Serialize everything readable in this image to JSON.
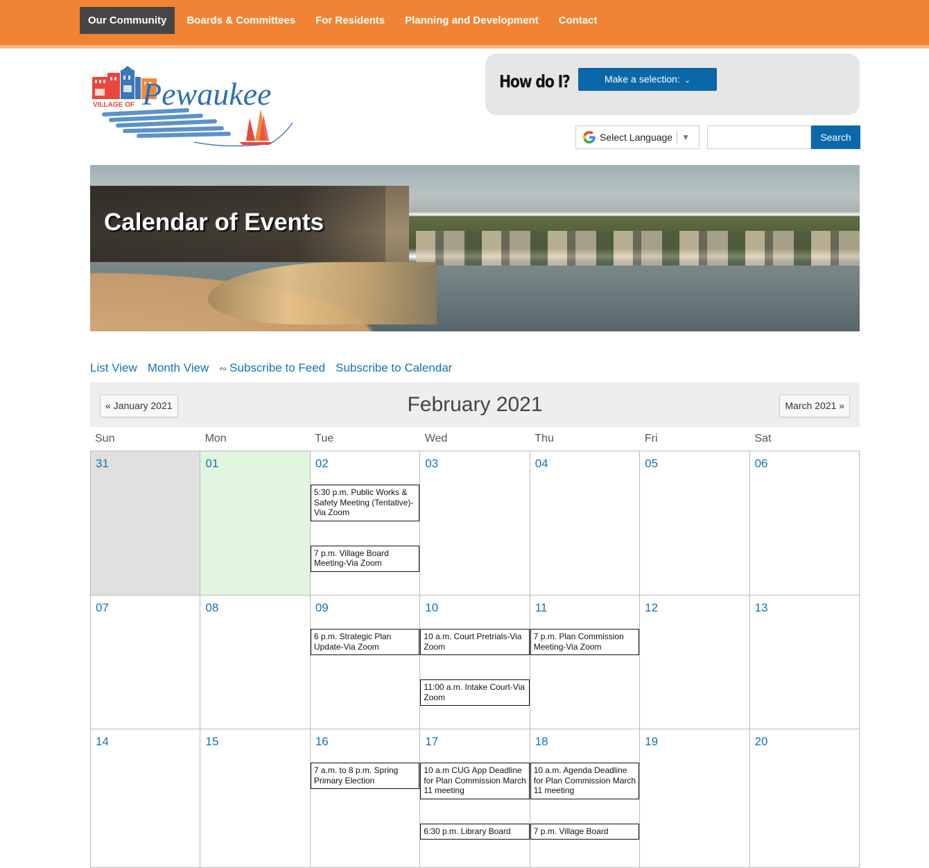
{
  "nav": {
    "items": [
      {
        "label": "Our Community",
        "active": true
      },
      {
        "label": "Boards & Committees",
        "active": false
      },
      {
        "label": "For Residents",
        "active": false
      },
      {
        "label": "Planning and Development",
        "active": false
      },
      {
        "label": "Contact",
        "active": false
      }
    ]
  },
  "logo": {
    "prefix": "VILLAGE OF",
    "name": "Pewaukee"
  },
  "howdoi": {
    "label": "How do I?",
    "select_label": "Make a selection:"
  },
  "language": {
    "label": "Select Language"
  },
  "search": {
    "value": "",
    "placeholder": "",
    "button_label": "Search"
  },
  "hero": {
    "title": "Calendar of Events"
  },
  "view_links": {
    "list_view": "List View",
    "month_view": "Month View",
    "subscribe_feed": "Subscribe to Feed",
    "subscribe_calendar": "Subscribe to Calendar"
  },
  "calendar": {
    "prev_label": "« January 2021",
    "next_label": "March 2021 »",
    "month_title": "February 2021",
    "weekdays": [
      "Sun",
      "Mon",
      "Tue",
      "Wed",
      "Thu",
      "Fri",
      "Sat"
    ],
    "weeks": [
      [
        {
          "day": "31",
          "state": "other",
          "events": []
        },
        {
          "day": "01",
          "state": "today",
          "events": []
        },
        {
          "day": "02",
          "state": "",
          "events": [
            "5:30 p.m. Public Works & Safety Meeting (Tentative)-Via Zoom",
            "7 p.m. Village Board Meeting-Via Zoom"
          ]
        },
        {
          "day": "03",
          "state": "",
          "events": []
        },
        {
          "day": "04",
          "state": "",
          "events": []
        },
        {
          "day": "05",
          "state": "",
          "events": []
        },
        {
          "day": "06",
          "state": "",
          "events": []
        }
      ],
      [
        {
          "day": "07",
          "state": "",
          "events": []
        },
        {
          "day": "08",
          "state": "",
          "events": []
        },
        {
          "day": "09",
          "state": "",
          "events": [
            "6 p.m. Strategic Plan Update-Via Zoom"
          ]
        },
        {
          "day": "10",
          "state": "",
          "events": [
            "10 a.m. Court Pretrials-Via Zoom",
            "11:00 a.m. Intake Court-Via Zoom"
          ]
        },
        {
          "day": "11",
          "state": "",
          "events": [
            "7 p.m. Plan Commission Meeting-Via Zoom"
          ]
        },
        {
          "day": "12",
          "state": "",
          "events": []
        },
        {
          "day": "13",
          "state": "",
          "events": []
        }
      ],
      [
        {
          "day": "14",
          "state": "",
          "events": []
        },
        {
          "day": "15",
          "state": "",
          "events": []
        },
        {
          "day": "16",
          "state": "",
          "events": [
            "7 a.m. to 8 p.m. Spring Primary Election"
          ]
        },
        {
          "day": "17",
          "state": "",
          "events": [
            "10 a.m CUG App Deadline for Plan Commission March 11 meeting",
            "6:30 p.m. Library Board"
          ]
        },
        {
          "day": "18",
          "state": "",
          "events": [
            "10 a.m. Agenda Deadline for Plan Commission March 11 meeting",
            "7 p.m. Village Board"
          ]
        },
        {
          "day": "19",
          "state": "",
          "events": []
        },
        {
          "day": "20",
          "state": "",
          "events": []
        }
      ]
    ]
  },
  "colors": {
    "nav_bg": "#f08434",
    "nav_active": "#464646",
    "accent_blue": "#0b68a8",
    "link_blue": "#1372b3",
    "today_bg": "#e1f5df",
    "other_month_bg": "#e0e0e0"
  }
}
